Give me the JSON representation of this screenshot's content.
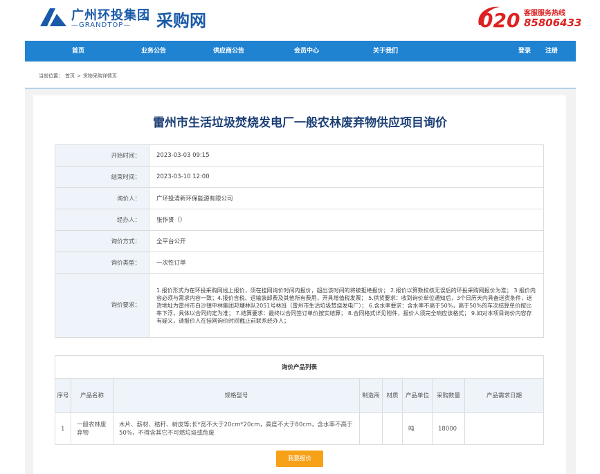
{
  "header": {
    "logo_cn": "广州环投集团",
    "logo_en": "—GRANDTOP—",
    "logo_dot": "·",
    "logo_sub": "采购网",
    "hotline_label": "客服服务热线",
    "hotline_area": "020",
    "hotline_number": "85806433"
  },
  "nav": {
    "items": [
      "首页",
      "业务公告",
      "供应商公告",
      "会员中心",
      "关于我们"
    ],
    "login": "登录",
    "register": "注册"
  },
  "breadcrumb": {
    "prefix": "当前位置：",
    "home": "首页",
    "sep": ">",
    "current": "货物采购详情页"
  },
  "page": {
    "title": "雷州市生活垃圾焚烧发电厂一般农林废弃物供应项目询价"
  },
  "info": [
    {
      "label": "开始时间：",
      "value": "2023-03-03 09:15"
    },
    {
      "label": "结束时间：",
      "value": "2023-03-10 12:00"
    },
    {
      "label": "询价人：",
      "value": "广环投清新环保能源有限公司"
    },
    {
      "label": "经办人：",
      "value": "张作贤（）"
    },
    {
      "label": "询价方式：",
      "value": "全平台公开"
    },
    {
      "label": "询价类型：",
      "value": "一次性订单"
    },
    {
      "label": "询价要求：",
      "value": "1.报价形式为在环投采购网线上报价，须在挂网询价时间内报价，超出该时间的将被拒绝报价； 2.报价以算数校核无误后的环投采购网报价为准； 3.报价内容必须与需求内容一致；4.报价含税、运输装卸费及其他所有费用，开具增值税发票； 5.供货要求：收到询价单位通知后，3个日历天内具备送货条件，送货地址为雷州市白沙镇中林集团邦塘林队2051号林班（雷州市生活垃圾焚烧发电厂）； 6.含水率要求：含水率不高于50%，高于50%的车次结算单价按比率下浮，具体以合同约定为准； 7.结算要求：最终以合同签订单价按实结算； 8.合同格式详见附件，报价人须完全响应该格式； 9.如对本项目询价内容存有疑义，请报价人在挂网询价时间截止前联系经办人；"
    }
  ],
  "products": {
    "caption": "询价产品列表",
    "headers": [
      "序号",
      "产品名称",
      "规格型号",
      "制造商",
      "材质",
      "产品单位",
      "采购数量",
      "产品需求日期"
    ],
    "rows": [
      {
        "no": "1",
        "name": "一般农林废弃物",
        "spec": "木片、薪材、秸秆、树皮等;长*宽不大于20cm*20cm，高度不大于80cm，含水率不高于50%，不得含其它不可燃垃圾或危废",
        "maker": "",
        "material": "",
        "unit": "吨",
        "qty": "18000",
        "date": ""
      }
    ]
  },
  "actions": {
    "quote": "我要报价"
  },
  "colors": {
    "brand": "#1a5aa8",
    "nav": "#1f83d2",
    "title": "#1c3f75",
    "hotline": "#dd2222",
    "button": "#f7a118"
  }
}
